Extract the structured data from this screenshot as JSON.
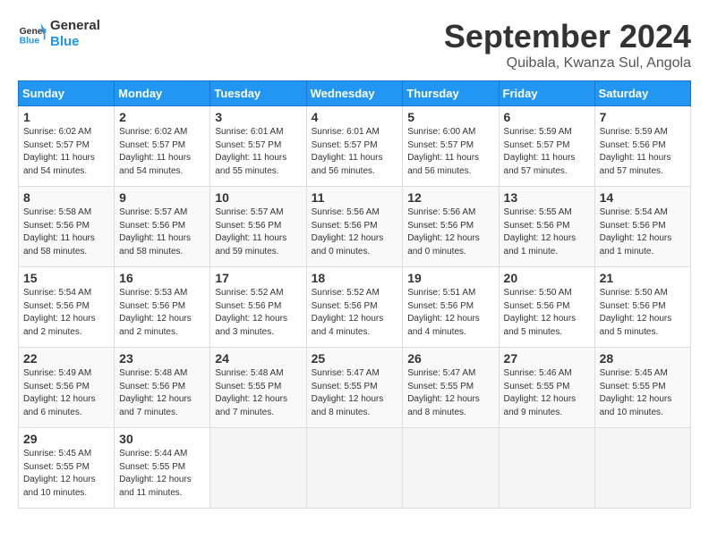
{
  "header": {
    "logo_line1": "General",
    "logo_line2": "Blue",
    "month": "September 2024",
    "location": "Quibala, Kwanza Sul, Angola"
  },
  "days_of_week": [
    "Sunday",
    "Monday",
    "Tuesday",
    "Wednesday",
    "Thursday",
    "Friday",
    "Saturday"
  ],
  "weeks": [
    [
      {
        "day": "1",
        "sunrise": "6:02 AM",
        "sunset": "5:57 PM",
        "daylight": "11 hours and 54 minutes."
      },
      {
        "day": "2",
        "sunrise": "6:02 AM",
        "sunset": "5:57 PM",
        "daylight": "11 hours and 54 minutes."
      },
      {
        "day": "3",
        "sunrise": "6:01 AM",
        "sunset": "5:57 PM",
        "daylight": "11 hours and 55 minutes."
      },
      {
        "day": "4",
        "sunrise": "6:01 AM",
        "sunset": "5:57 PM",
        "daylight": "11 hours and 56 minutes."
      },
      {
        "day": "5",
        "sunrise": "6:00 AM",
        "sunset": "5:57 PM",
        "daylight": "11 hours and 56 minutes."
      },
      {
        "day": "6",
        "sunrise": "5:59 AM",
        "sunset": "5:57 PM",
        "daylight": "11 hours and 57 minutes."
      },
      {
        "day": "7",
        "sunrise": "5:59 AM",
        "sunset": "5:56 PM",
        "daylight": "11 hours and 57 minutes."
      }
    ],
    [
      {
        "day": "8",
        "sunrise": "5:58 AM",
        "sunset": "5:56 PM",
        "daylight": "11 hours and 58 minutes."
      },
      {
        "day": "9",
        "sunrise": "5:57 AM",
        "sunset": "5:56 PM",
        "daylight": "11 hours and 58 minutes."
      },
      {
        "day": "10",
        "sunrise": "5:57 AM",
        "sunset": "5:56 PM",
        "daylight": "11 hours and 59 minutes."
      },
      {
        "day": "11",
        "sunrise": "5:56 AM",
        "sunset": "5:56 PM",
        "daylight": "12 hours and 0 minutes."
      },
      {
        "day": "12",
        "sunrise": "5:56 AM",
        "sunset": "5:56 PM",
        "daylight": "12 hours and 0 minutes."
      },
      {
        "day": "13",
        "sunrise": "5:55 AM",
        "sunset": "5:56 PM",
        "daylight": "12 hours and 1 minute."
      },
      {
        "day": "14",
        "sunrise": "5:54 AM",
        "sunset": "5:56 PM",
        "daylight": "12 hours and 1 minute."
      }
    ],
    [
      {
        "day": "15",
        "sunrise": "5:54 AM",
        "sunset": "5:56 PM",
        "daylight": "12 hours and 2 minutes."
      },
      {
        "day": "16",
        "sunrise": "5:53 AM",
        "sunset": "5:56 PM",
        "daylight": "12 hours and 2 minutes."
      },
      {
        "day": "17",
        "sunrise": "5:52 AM",
        "sunset": "5:56 PM",
        "daylight": "12 hours and 3 minutes."
      },
      {
        "day": "18",
        "sunrise": "5:52 AM",
        "sunset": "5:56 PM",
        "daylight": "12 hours and 4 minutes."
      },
      {
        "day": "19",
        "sunrise": "5:51 AM",
        "sunset": "5:56 PM",
        "daylight": "12 hours and 4 minutes."
      },
      {
        "day": "20",
        "sunrise": "5:50 AM",
        "sunset": "5:56 PM",
        "daylight": "12 hours and 5 minutes."
      },
      {
        "day": "21",
        "sunrise": "5:50 AM",
        "sunset": "5:56 PM",
        "daylight": "12 hours and 5 minutes."
      }
    ],
    [
      {
        "day": "22",
        "sunrise": "5:49 AM",
        "sunset": "5:56 PM",
        "daylight": "12 hours and 6 minutes."
      },
      {
        "day": "23",
        "sunrise": "5:48 AM",
        "sunset": "5:56 PM",
        "daylight": "12 hours and 7 minutes."
      },
      {
        "day": "24",
        "sunrise": "5:48 AM",
        "sunset": "5:55 PM",
        "daylight": "12 hours and 7 minutes."
      },
      {
        "day": "25",
        "sunrise": "5:47 AM",
        "sunset": "5:55 PM",
        "daylight": "12 hours and 8 minutes."
      },
      {
        "day": "26",
        "sunrise": "5:47 AM",
        "sunset": "5:55 PM",
        "daylight": "12 hours and 8 minutes."
      },
      {
        "day": "27",
        "sunrise": "5:46 AM",
        "sunset": "5:55 PM",
        "daylight": "12 hours and 9 minutes."
      },
      {
        "day": "28",
        "sunrise": "5:45 AM",
        "sunset": "5:55 PM",
        "daylight": "12 hours and 10 minutes."
      }
    ],
    [
      {
        "day": "29",
        "sunrise": "5:45 AM",
        "sunset": "5:55 PM",
        "daylight": "12 hours and 10 minutes."
      },
      {
        "day": "30",
        "sunrise": "5:44 AM",
        "sunset": "5:55 PM",
        "daylight": "12 hours and 11 minutes."
      },
      null,
      null,
      null,
      null,
      null
    ]
  ]
}
